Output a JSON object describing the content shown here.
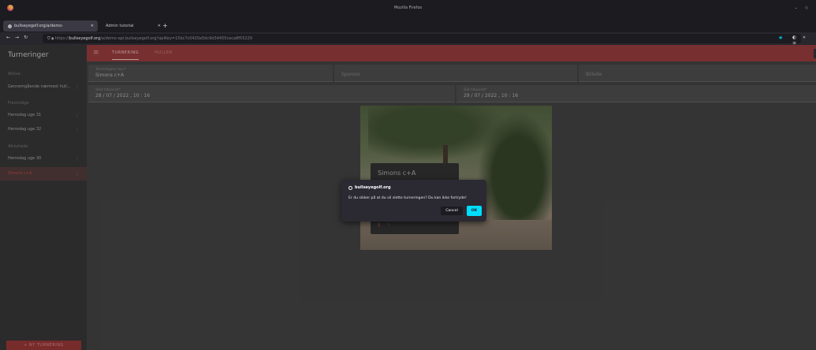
{
  "browser": {
    "window_title": "Mozilla Firefox",
    "tabs": [
      {
        "label": "bullseyegolf.org/a/demo-",
        "active": true
      },
      {
        "label": "Admin tutorial",
        "active": false
      }
    ],
    "new_tab": "+",
    "url": {
      "scheme": "https://",
      "host": "bullseyegolf.org",
      "path": "/a/demo-api.bullseyegolf.org?apiKey=15bc7c0420a5dc9d34455ceca8f55229"
    }
  },
  "sidebar": {
    "title": "Turneringer",
    "sections": {
      "active": "Aktive",
      "upcoming": "Fremtidige",
      "finished": "Afsluttede"
    },
    "items": [
      {
        "label": "Gennemgående nærmest hull..."
      },
      {
        "label": "Herredag uge 31"
      },
      {
        "label": "Herredag uge 32"
      },
      {
        "label": "Herredag uge 30"
      },
      {
        "label": "Simons c+A"
      }
    ],
    "new_button": "+ NY TURNERING"
  },
  "topbar": {
    "tabs": [
      "TURNERING",
      "HULLER"
    ]
  },
  "form": {
    "name_label": "Turneringens navn*",
    "name_value": "Simons c+A",
    "sponsor_placeholder": "Sponsor",
    "image_placeholder": "Billede",
    "start_label": "Start tidspunkt*",
    "start_value": "28 / 07 / 2022 , 10 : 16",
    "end_label": "Slut tidspunkt*",
    "end_value": "29 / 07 / 2022 , 10 : 16"
  },
  "preview": {
    "card_name": "Simons c+A"
  },
  "dialog": {
    "origin": "bullseyegolf.org",
    "message": "Er du sikker på at du vil slette turneringen? Du kan ikke fortryde!",
    "cancel": "Cancel",
    "ok": "OK"
  }
}
